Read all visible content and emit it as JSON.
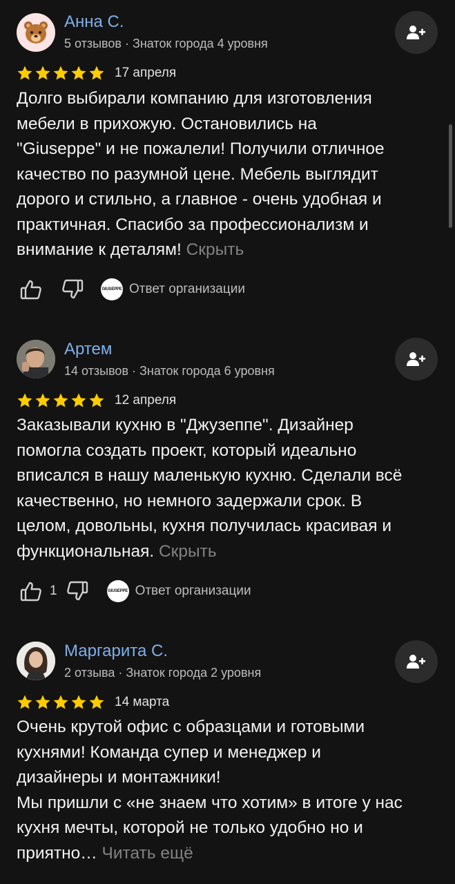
{
  "colors": {
    "background": "#131313",
    "name": "#7fb0ec",
    "star": "#ffcc00",
    "muted": "#828282"
  },
  "reviews": [
    {
      "author": "Анна С.",
      "meta": "5 отзывов · Знаток города 4 уровня",
      "rating": 5,
      "date": "17 апреля",
      "text_lines": [
        "Долго выбирали компанию для изготовления",
        "мебели в прихожую. Остановились на",
        "\"Giuseppe\" и не пожалели! Получили отличное",
        "качество по разумной цене. Мебель выглядит",
        "дорого и стильно, а главное - очень удобная и",
        "практичная. Спасибо за профессионализм и",
        "внимание к деталям!"
      ],
      "toggle": "Скрыть",
      "likes": "",
      "org_logo": "GIUSEPPE",
      "org_reply": "Ответ организации",
      "avatar_icon": "bear-avatar-icon"
    },
    {
      "author": "Артем",
      "meta": "14 отзывов · Знаток города 6 уровня",
      "rating": 5,
      "date": "12 апреля",
      "text_lines": [
        "Заказывали кухню в \"Джузеппе\". Дизайнер",
        "помогла создать проект, который идеально",
        "вписался в нашу маленькую кухню. Сделали всё",
        "качественно, но немного задержали срок. В",
        "целом, довольны, кухня получилась красивая и",
        "функциональная."
      ],
      "toggle": "Скрыть",
      "likes": "1",
      "org_logo": "GIUSEPPE",
      "org_reply": "Ответ организации",
      "avatar_icon": "user-photo-avatar"
    },
    {
      "author": "Маргарита С.",
      "meta": "2 отзыва · Знаток города 2 уровня",
      "rating": 5,
      "date": "14 марта",
      "text_lines": [
        "Очень крутой офис с образцами и готовыми",
        "кухнями! Команда супер и менеджер и",
        "дизайнеры и монтажники!",
        "Мы пришли с «не знаем что хотим» в итоге у нас",
        "кухня мечты, которой не только удобно но и",
        "приятно…"
      ],
      "toggle": "Читать ещё",
      "likes": "",
      "org_logo": "",
      "org_reply": "",
      "avatar_icon": "user-photo-avatar"
    }
  ]
}
